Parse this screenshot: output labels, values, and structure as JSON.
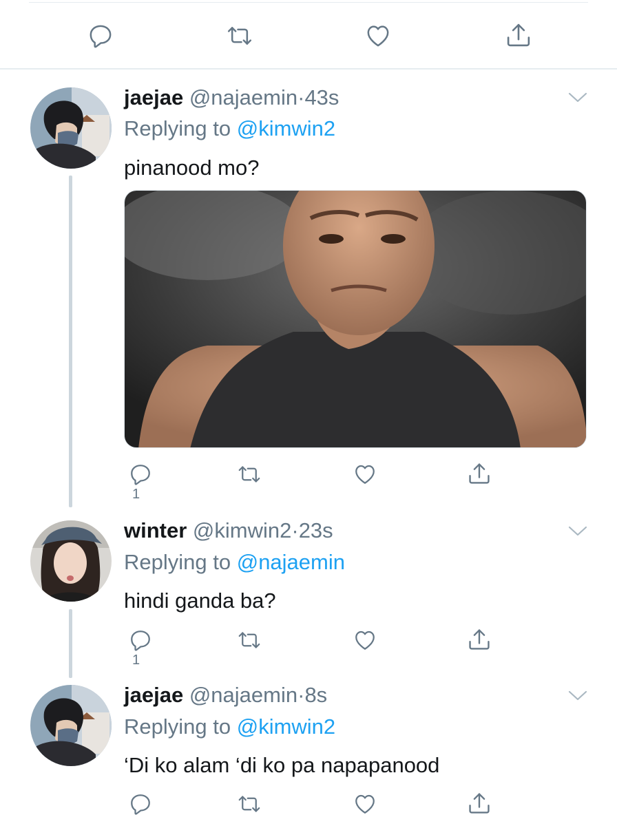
{
  "top_actions": {
    "reply_icon": "reply-icon",
    "retweet_icon": "retweet-icon",
    "like_icon": "heart-icon",
    "share_icon": "share-icon"
  },
  "tweets": [
    {
      "name": "jaejae",
      "handle": "@najaemin",
      "dot": "·",
      "time": "43s",
      "replying_prefix": "Replying to ",
      "replying_to": "@kimwin2",
      "text": "pinanood mo?",
      "has_media": true,
      "reply_count": "1"
    },
    {
      "name": "winter",
      "handle": "@kimwin2",
      "dot": "·",
      "time": "23s",
      "replying_prefix": "Replying to ",
      "replying_to": "@najaemin",
      "text": "hindi ganda ba?",
      "has_media": false,
      "reply_count": "1"
    },
    {
      "name": "jaejae",
      "handle": "@najaemin",
      "dot": "·",
      "time": "8s",
      "replying_prefix": "Replying to ",
      "replying_to": "@kimwin2",
      "text": "‘Di ko alam ‘di ko pa napapanood",
      "has_media": false,
      "reply_count": ""
    }
  ],
  "colors": {
    "accent": "#1da1f2",
    "muted": "#657786",
    "text": "#14171a",
    "divider": "#e6ecf0",
    "thread_line": "#ccd6dd"
  }
}
